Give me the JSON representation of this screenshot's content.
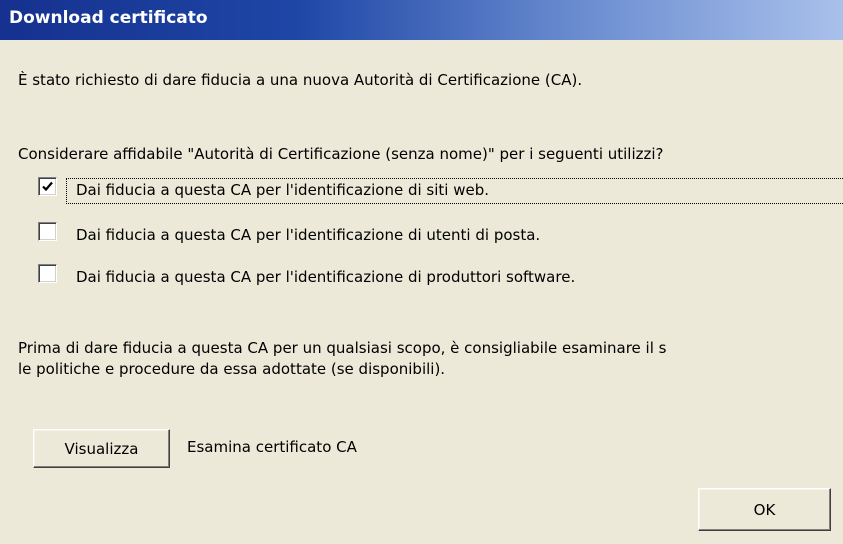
{
  "dialog": {
    "title": "Download certificato",
    "intro": "È stato richiesto di dare fiducia a una nuova Autorità di Certificazione (CA).",
    "question": "Considerare affidabile \"Autorità di Certificazione (senza nome)\" per i seguenti utilizzi?",
    "options": [
      {
        "label": "Dai fiducia a questa CA per l'identificazione di siti web.",
        "checked": true
      },
      {
        "label": "Dai fiducia a questa CA per l'identificazione di utenti di posta.",
        "checked": false
      },
      {
        "label": "Dai fiducia a questa CA per l'identificazione di produttori software.",
        "checked": false
      }
    ],
    "advice_line1": "Prima di dare fiducia a questa CA per un qualsiasi scopo, è consigliabile esaminare il s",
    "advice_line2": "le politiche e procedure da essa adottate (se disponibili).",
    "view_button": "Visualizza",
    "view_description": "Esamina certificato CA",
    "ok_button": "OK"
  }
}
